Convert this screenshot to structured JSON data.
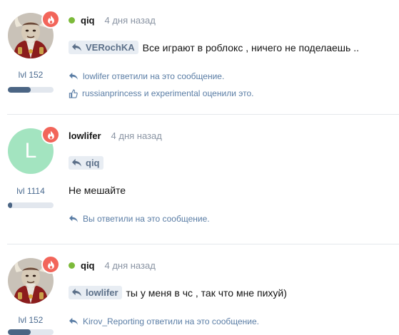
{
  "posts": [
    {
      "username": "qiq",
      "online": true,
      "time": "4 дня назад",
      "level": "lvl 152",
      "level_progress": 0.5,
      "avatar": "demon-avatar",
      "quote_user": "VERochKA",
      "text": "Все играют в роблокс , ничего не поделаешь ..",
      "reply_note": "lowlifer ответили на это сообщение.",
      "like_note": "russianprincess и experimental оценили это."
    },
    {
      "username": "lowlifer",
      "online": false,
      "time": "4 дня назад",
      "level": "lvl 1114",
      "level_progress": 0.1,
      "avatar_letter": "L",
      "quote_user": "qiq",
      "text": "Не мешайте",
      "reply_note": "Вы ответили на это сообщение."
    },
    {
      "username": "qiq",
      "online": true,
      "time": "4 дня назад",
      "level": "lvl 152",
      "level_progress": 0.5,
      "avatar": "demon-avatar",
      "quote_user": "lowlifer",
      "text": "ты у меня в чс , так что мне пихуй)",
      "reply_note": "Kirov_Reporting ответили на это сообщение."
    }
  ],
  "colors": {
    "accent": "#4b6584",
    "online": "#7cba3a",
    "badge": "#f2655a",
    "link": "#5a7da5"
  },
  "icons": [
    "flame-icon",
    "reply-icon",
    "like-icon",
    "online-dot"
  ]
}
